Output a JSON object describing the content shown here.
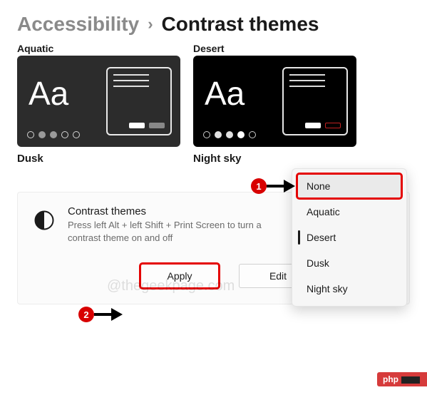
{
  "breadcrumb": {
    "parent": "Accessibility",
    "separator": "›",
    "current": "Contrast themes"
  },
  "tiles": {
    "top_labels": {
      "aquatic": "Aquatic",
      "desert": "Desert"
    },
    "sample_text": "Aa",
    "bottom_labels": {
      "dusk": "Dusk",
      "night_sky": "Night sky"
    }
  },
  "card": {
    "title": "Contrast themes",
    "subtitle": "Press left Alt + left Shift + Print Screen to turn a contrast theme on and off",
    "icon": "contrast-half-circle-icon"
  },
  "actions": {
    "apply": "Apply",
    "edit": "Edit"
  },
  "dropdown": {
    "items": [
      {
        "label": "None",
        "highlighted": true,
        "hover": true
      },
      {
        "label": "Aquatic"
      },
      {
        "label": "Desert",
        "selected": true
      },
      {
        "label": "Dusk"
      },
      {
        "label": "Night sky"
      }
    ]
  },
  "annotations": {
    "step1": "1",
    "step2": "2"
  },
  "watermark": "@thegeekpage.com",
  "footer_badge": "php"
}
